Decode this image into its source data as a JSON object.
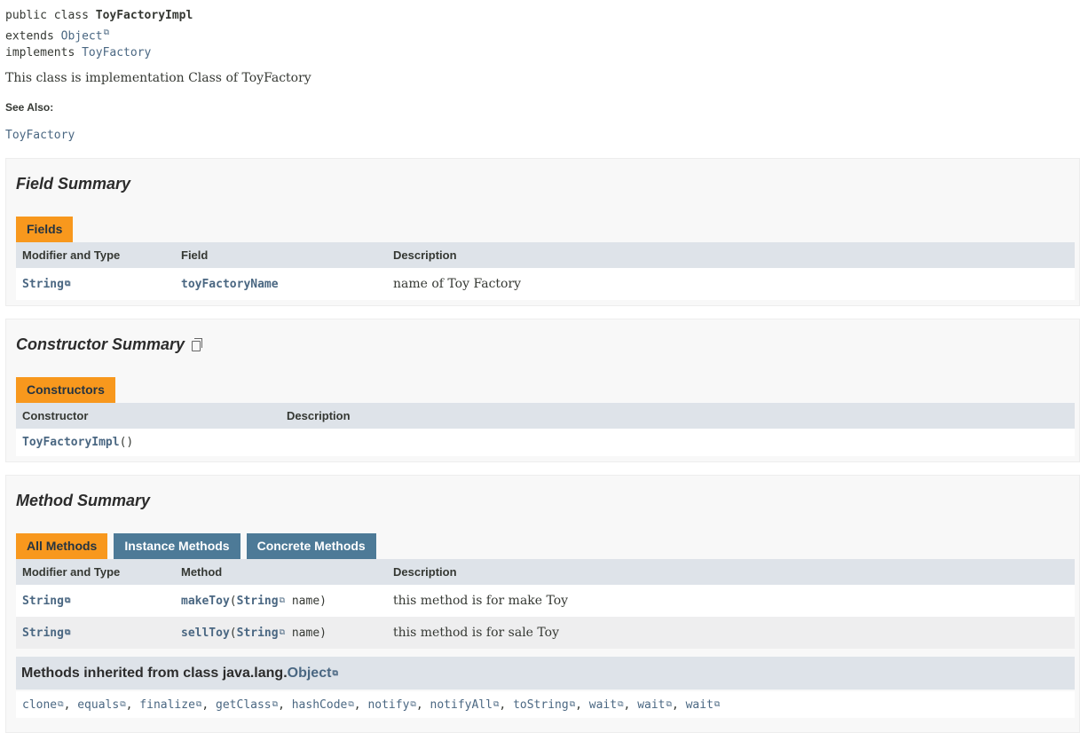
{
  "class_signature": {
    "line1_prefix": "public class ",
    "class_name": "ToyFactoryImpl",
    "line2_prefix": "extends ",
    "extends": "Object",
    "line3_prefix": "implements ",
    "implements": "ToyFactory"
  },
  "class_description": "This class is implementation Class of ToyFactory",
  "see_also": {
    "label": "See Also:",
    "link": "ToyFactory"
  },
  "field_summary": {
    "title": "Field Summary",
    "tab": "Fields",
    "headers": [
      "Modifier and Type",
      "Field",
      "Description"
    ],
    "rows": [
      {
        "type": "String",
        "name": "toyFactoryName",
        "description": "name of Toy Factory"
      }
    ]
  },
  "constructor_summary": {
    "title": "Constructor Summary",
    "tab": "Constructors",
    "headers": [
      "Constructor",
      "Description"
    ],
    "rows": [
      {
        "name": "ToyFactoryImpl",
        "params": "()",
        "description": ""
      }
    ]
  },
  "method_summary": {
    "title": "Method Summary",
    "tabs": [
      "All Methods",
      "Instance Methods",
      "Concrete Methods"
    ],
    "headers": [
      "Modifier and Type",
      "Method",
      "Description"
    ],
    "rows": [
      {
        "type": "String",
        "name": "makeToy",
        "param_open": "(",
        "param_type": "String",
        "param_rest": " name)",
        "description": "this method is for make Toy"
      },
      {
        "type": "String",
        "name": "sellToy",
        "param_open": "(",
        "param_type": "String",
        "param_rest": " name)",
        "description": "this method is for sale Toy"
      }
    ]
  },
  "inherited": {
    "prefix": "Methods inherited from class java.lang.",
    "class_link": "Object",
    "methods": [
      "clone",
      "equals",
      "finalize",
      "getClass",
      "hashCode",
      "notify",
      "notifyAll",
      "toString",
      "wait",
      "wait",
      "wait"
    ],
    "separator": ", "
  },
  "icons": {
    "external_link": "external-link-icon",
    "copy": "copy-icon"
  },
  "colors": {
    "active_tab": "#f8981d",
    "inactive_tab": "#4d7a97",
    "header_bg": "#dee3e9",
    "link": "#4a6782"
  }
}
